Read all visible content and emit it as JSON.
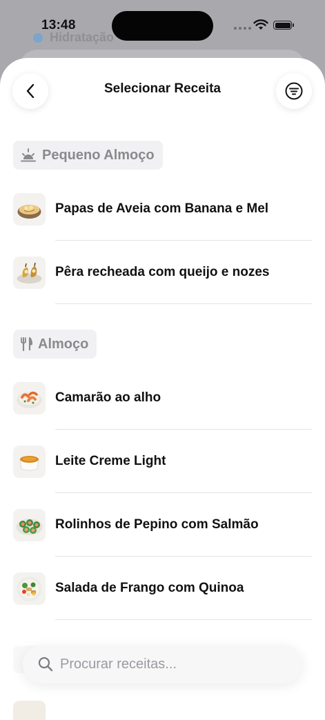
{
  "status_bar": {
    "time": "13:48"
  },
  "background": {
    "item_label": "Hidratação"
  },
  "header": {
    "title": "Selecionar Receita",
    "back_icon": "chevron-left-icon",
    "filter_icon": "filter-lines-icon"
  },
  "sections": [
    {
      "title": "Pequeno Almoço",
      "icon": "sunrise-icon",
      "recipes": [
        {
          "name": "Papas de Aveia com Banana e Mel",
          "image": "oatmeal-bowl-image"
        },
        {
          "name": "Pêra recheada com queijo e nozes",
          "image": "stuffed-pear-image"
        }
      ]
    },
    {
      "title": "Almoço",
      "icon": "fork-knife-icon",
      "recipes": [
        {
          "name": "Camarão ao alho",
          "image": "garlic-shrimp-image"
        },
        {
          "name": "Leite Creme Light",
          "image": "creme-brulee-image"
        },
        {
          "name": "Rolinhos de Pepino com Salmão",
          "image": "cucumber-salmon-rolls-image"
        },
        {
          "name": "Salada de Frango com Quinoa",
          "image": "chicken-quinoa-salad-image"
        }
      ]
    }
  ],
  "search": {
    "placeholder": "Procurar receitas...",
    "value": ""
  },
  "colors": {
    "sheet_background": "#ffffff",
    "chip_background": "#f1f1f3",
    "chip_text": "#8a8a8e",
    "divider": "#e3e3e6",
    "placeholder": "#9a9aa0"
  }
}
